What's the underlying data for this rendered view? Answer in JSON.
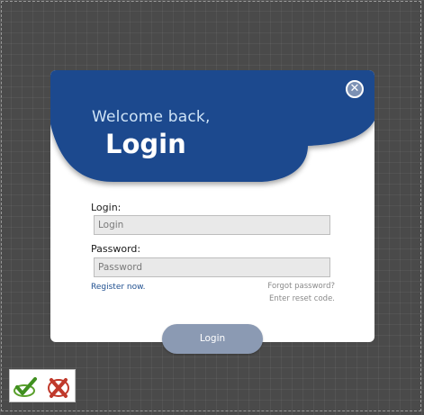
{
  "dialog": {
    "welcome_text": "Welcome back,",
    "title": "Login",
    "close_icon": "close-icon",
    "header_color": "#1e4a8e"
  },
  "form": {
    "login_label": "Login:",
    "login_placeholder": "Login",
    "password_label": "Password:",
    "password_placeholder": "Password",
    "register_link": "Register now.",
    "forgot_link": "Forgot password?",
    "reset_link": "Enter reset code.",
    "submit_label": "Login"
  },
  "tray": {
    "accept_icon": "checkmark-icon",
    "reject_icon": "cross-icon"
  }
}
